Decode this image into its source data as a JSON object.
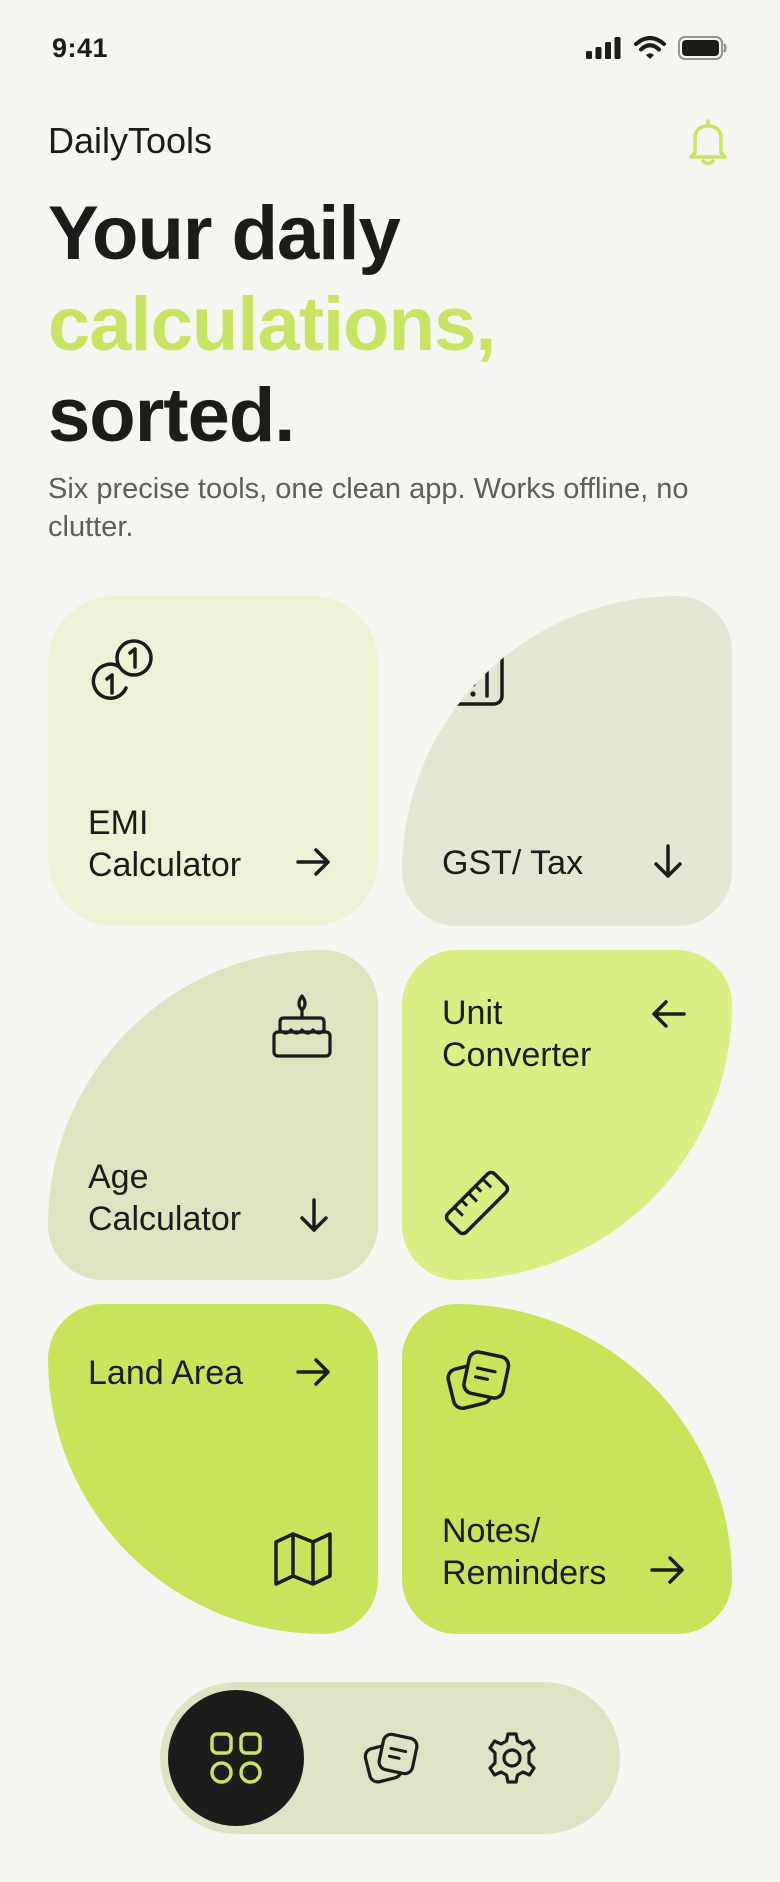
{
  "status_bar": {
    "time": "9:41"
  },
  "header": {
    "brand": "DailyTools"
  },
  "hero": {
    "line1": "Your daily",
    "line2": "calculations,",
    "line3": "sorted.",
    "subtitle": "Six precise tools, one clean app. Works offline, no clutter."
  },
  "tools": {
    "emi": {
      "line1": "EMI",
      "line2": "Calculator",
      "icon": "coins-icon"
    },
    "gst": {
      "label": "GST/ Tax",
      "icon": "calculator-icon"
    },
    "age": {
      "line1": "Age",
      "line2": "Calculator",
      "icon": "cake-icon"
    },
    "unit": {
      "line1": "Unit",
      "line2": "Converter",
      "icon": "ruler-icon"
    },
    "land": {
      "label": "Land Area",
      "icon": "map-icon"
    },
    "notes": {
      "line1": "Notes/",
      "line2": "Reminders",
      "icon": "notes-icon"
    }
  },
  "bottom_nav": {
    "items": [
      {
        "name": "home",
        "icon": "grid-icon",
        "active": true
      },
      {
        "name": "notes",
        "icon": "notes-icon",
        "active": false
      },
      {
        "name": "settings",
        "icon": "gear-icon",
        "active": false
      }
    ]
  },
  "colors": {
    "accent": "#c8e463",
    "tile_pale": "#edf1d6",
    "tile_grey": "#e3e6d2",
    "tile_sage": "#dde4c0",
    "tile_light_lime": "#d9ef86",
    "tile_lime": "#c8e45b",
    "dark": "#1c1d1b"
  }
}
